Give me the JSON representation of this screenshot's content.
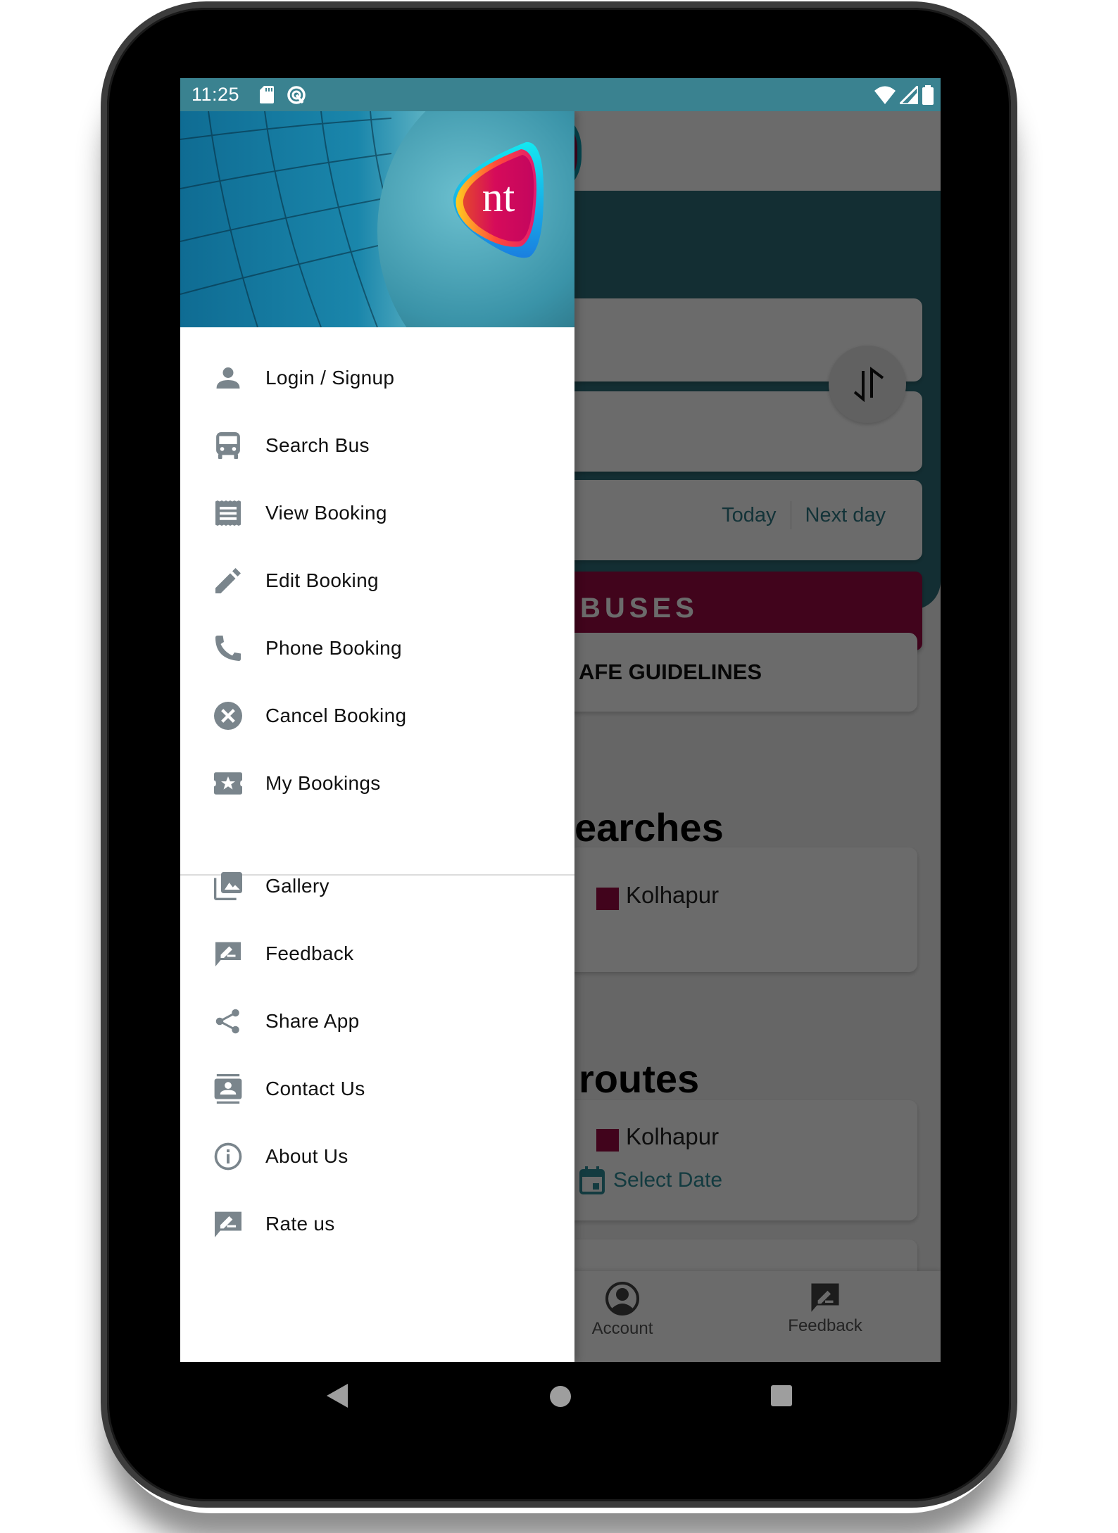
{
  "status_bar": {
    "time": "11:25",
    "left_icons": [
      "sd-card-icon",
      "data-saver-icon"
    ],
    "right_icons": [
      "wifi-icon",
      "signal-icon",
      "battery-icon"
    ]
  },
  "colors": {
    "status_bar": "#3a8290",
    "brand_teal": "#2f6f7a",
    "accent_magenta": "#9c0a44",
    "link_teal": "#2f8c98",
    "drawer_icon": "#7a858c"
  },
  "drawer": {
    "header": {
      "logo_text": "nt"
    },
    "primary_items": [
      {
        "label": "Login / Signup",
        "icon": "person-icon"
      },
      {
        "label": "Search Bus",
        "icon": "bus-icon"
      },
      {
        "label": "View Booking",
        "icon": "receipt-icon"
      },
      {
        "label": "Edit Booking",
        "icon": "pencil-icon"
      },
      {
        "label": "Phone Booking",
        "icon": "phone-icon"
      },
      {
        "label": "Cancel Booking",
        "icon": "cancel-circle-icon"
      },
      {
        "label": "My Bookings",
        "icon": "ticket-star-icon"
      }
    ],
    "secondary_items": [
      {
        "label": "Gallery",
        "icon": "gallery-icon"
      },
      {
        "label": "Feedback",
        "icon": "rate-review-icon"
      },
      {
        "label": "Share App",
        "icon": "share-icon"
      },
      {
        "label": "Contact Us",
        "icon": "contacts-icon"
      },
      {
        "label": "About Us",
        "icon": "info-icon"
      },
      {
        "label": "Rate us",
        "icon": "rate-review-icon"
      }
    ]
  },
  "background_app": {
    "date_quick": {
      "today": "Today",
      "next_day": "Next day"
    },
    "search_button_visible_label": "BUSES",
    "guidelines_visible_label": "AFE GUIDELINES",
    "recent_heading_visible": "earches",
    "recent_search": {
      "destination": "Kolhapur"
    },
    "routes_heading_visible": "routes",
    "route_card": {
      "destination": "Kolhapur",
      "select_date": "Select Date"
    },
    "bottom_nav": [
      {
        "label": "Account",
        "icon": "account-circle-icon"
      },
      {
        "label": "Feedback",
        "icon": "rate-review-icon"
      }
    ]
  },
  "system_nav": [
    "back",
    "home",
    "recents"
  ]
}
